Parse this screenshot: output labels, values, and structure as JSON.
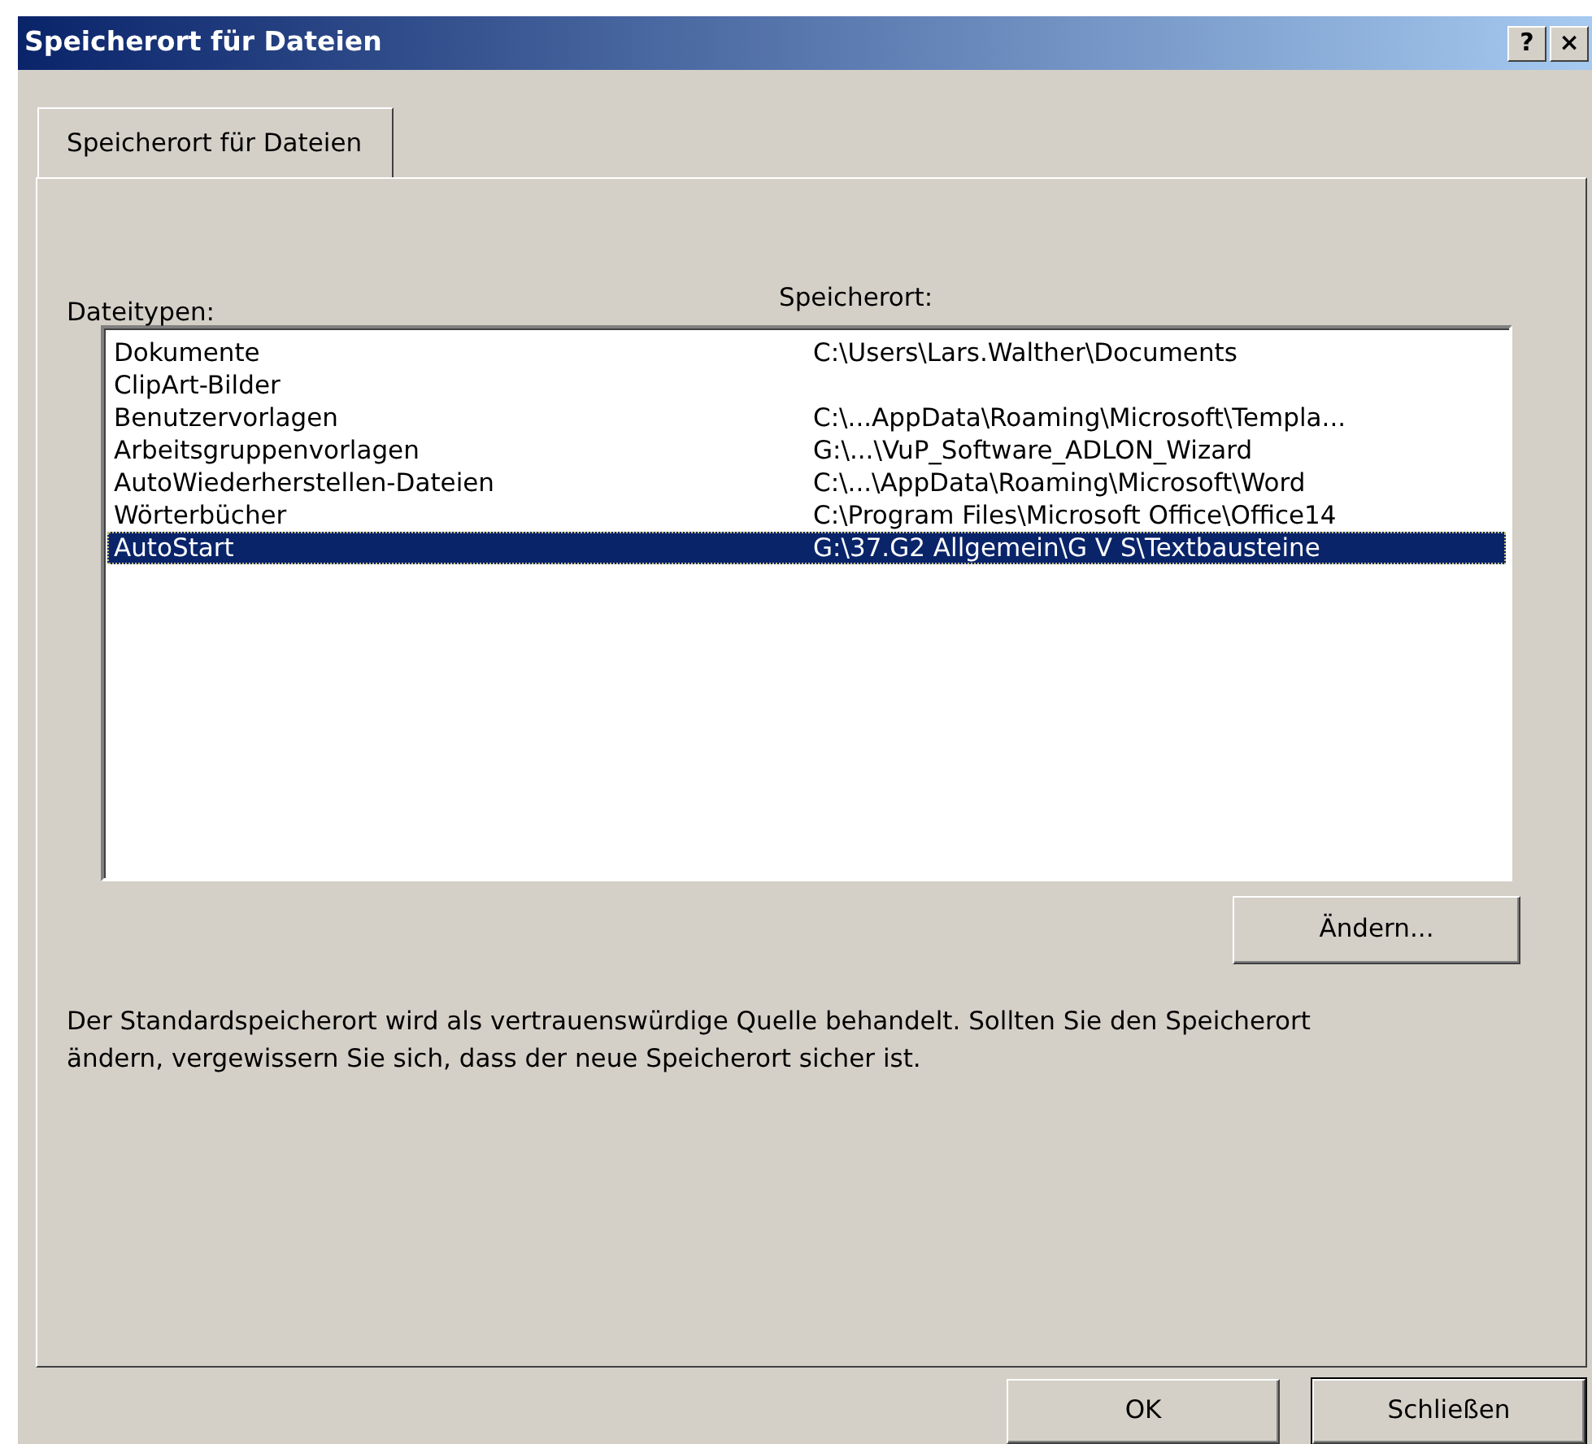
{
  "window": {
    "title": "Speicherort für Dateien",
    "help_button": "?",
    "close_button": "×"
  },
  "tabs": [
    {
      "label": "Speicherort für Dateien",
      "selected": true
    }
  ],
  "list": {
    "columns": [
      "Dateitypen:",
      "Speicherort:"
    ],
    "rows": [
      {
        "type": "Dokumente",
        "location": "C:\\Users\\Lars.Walther\\Documents",
        "selected": false
      },
      {
        "type": "ClipArt-Bilder",
        "location": "",
        "selected": false
      },
      {
        "type": "Benutzervorlagen",
        "location": "C:\\...AppData\\Roaming\\Microsoft\\Templa...",
        "selected": false
      },
      {
        "type": "Arbeitsgruppenvorlagen",
        "location": "G:\\...\\VuP_Software_ADLON_Wizard",
        "selected": false
      },
      {
        "type": "AutoWiederherstellen-Dateien",
        "location": "C:\\...\\AppData\\Roaming\\Microsoft\\Word",
        "selected": false
      },
      {
        "type": "Wörterbücher",
        "location": "C:\\Program Files\\Microsoft Office\\Office14",
        "selected": false
      },
      {
        "type": "AutoStart",
        "location": "G:\\37.G2  Allgemein\\G V S\\Textbausteine",
        "selected": true
      }
    ]
  },
  "change_button": "Ändern...",
  "note": "Der Standardspeicherort wird als vertrauenswürdige Quelle behandelt. Sollten Sie den Speicherort ändern, vergewissern Sie sich, dass der neue Speicherort sicher ist.",
  "buttons": [
    {
      "label": "OK",
      "default": false
    },
    {
      "label": "Schließen",
      "default": true
    }
  ]
}
